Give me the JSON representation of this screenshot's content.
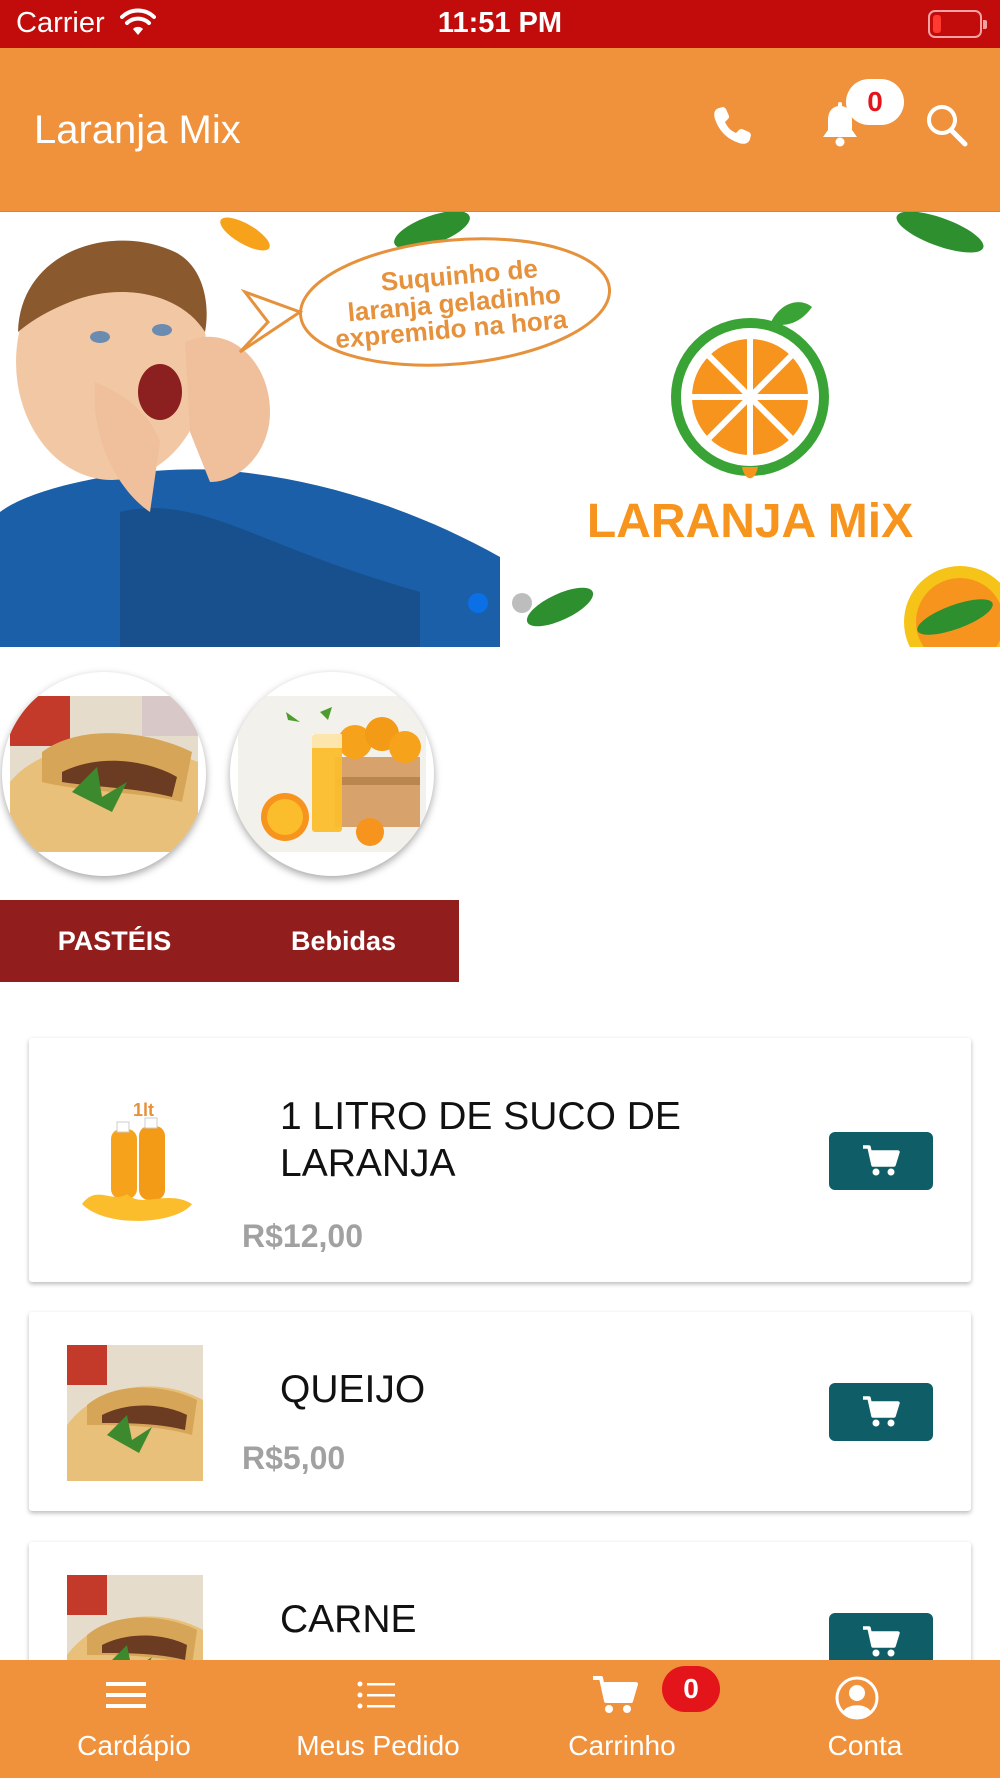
{
  "status_bar": {
    "carrier": "Carrier",
    "time": "11:51 PM"
  },
  "header": {
    "title": "Laranja Mix",
    "notification_count": "0",
    "icons": [
      "phone-icon",
      "bell-icon",
      "search-icon"
    ]
  },
  "banner": {
    "speech_bubble": [
      "Suquinho de",
      "laranja geladinho",
      "expremido na hora"
    ],
    "logo_text": "LARANJA MiX",
    "slides": 2,
    "active_slide": 1
  },
  "categories": [
    {
      "name": "pasteis-category-image"
    },
    {
      "name": "bebidas-category-image"
    }
  ],
  "tabs": [
    {
      "label": "PASTÉIS"
    },
    {
      "label": "Bebidas"
    }
  ],
  "products": [
    {
      "name_line1": "1 LITRO DE SUCO DE",
      "name_line2": "LARANJA",
      "price": "R$12,00",
      "thumb_text": "1lt"
    },
    {
      "name_line1": "QUEIJO",
      "price": "R$5,00"
    },
    {
      "name_line1": "CARNE"
    }
  ],
  "bottom_nav": {
    "items": [
      {
        "label": "Cardápio",
        "icon": "menu-icon"
      },
      {
        "label": "Meus Pedido",
        "icon": "list-icon"
      },
      {
        "label": "Carrinho",
        "icon": "cart-icon"
      },
      {
        "label": "Conta",
        "icon": "user-icon"
      }
    ],
    "cart_count": "0"
  },
  "colors": {
    "status_bar": "#c20c0c",
    "header": "#f0913c",
    "tabs": "#921d1d",
    "cart_button": "#0f5e67",
    "badge": "#e4141b",
    "price": "#a1a1a1"
  }
}
